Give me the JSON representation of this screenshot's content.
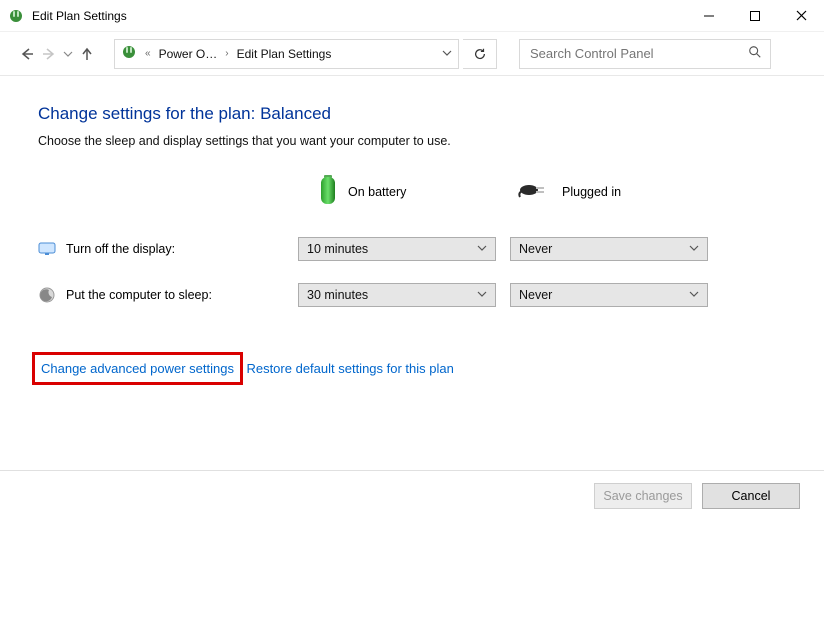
{
  "titlebar": {
    "title": "Edit Plan Settings"
  },
  "breadcrumb": {
    "item1": "Power O…",
    "item2": "Edit Plan Settings"
  },
  "search": {
    "placeholder": "Search Control Panel"
  },
  "heading": "Change settings for the plan: Balanced",
  "subheading": "Choose the sleep and display settings that you want your computer to use.",
  "columns": {
    "battery": "On battery",
    "plugged": "Plugged in"
  },
  "rows": {
    "display": {
      "label": "Turn off the display:",
      "battery": "10 minutes",
      "plugged": "Never"
    },
    "sleep": {
      "label": "Put the computer to sleep:",
      "battery": "30 minutes",
      "plugged": "Never"
    }
  },
  "links": {
    "advanced": "Change advanced power settings",
    "restore": "Restore default settings for this plan"
  },
  "buttons": {
    "save": "Save changes",
    "cancel": "Cancel"
  }
}
